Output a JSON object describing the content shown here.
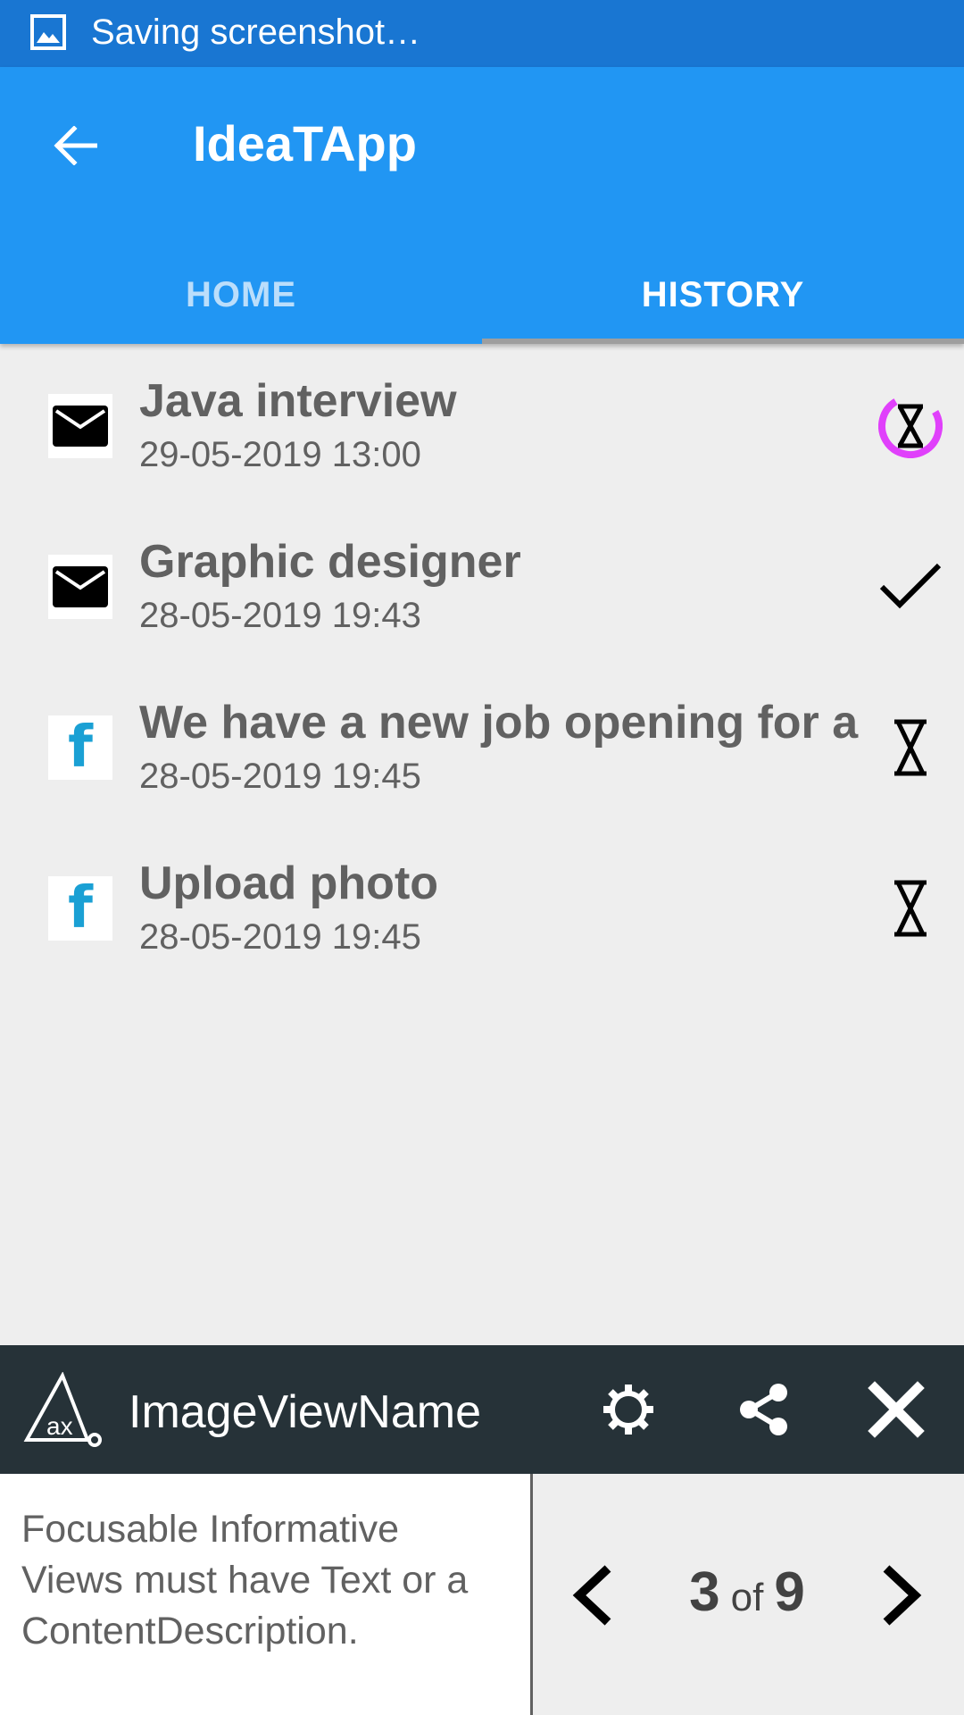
{
  "status_bar": {
    "icon": "image-icon",
    "text": "Saving screenshot…"
  },
  "app_bar": {
    "back_icon": "arrow-left-icon",
    "title": "IdeaTApp",
    "tabs": [
      {
        "label": "HOME",
        "selected": false
      },
      {
        "label": "HISTORY",
        "selected": true
      }
    ]
  },
  "history": {
    "items": [
      {
        "icon": "mail-icon",
        "title": "Java interview",
        "date": "29-05-2019 13:00",
        "status": "pending-hourglass-icon"
      },
      {
        "icon": "mail-icon",
        "title": "Graphic designer",
        "date": "28-05-2019 19:43",
        "status": "check-icon"
      },
      {
        "icon": "facebook-icon",
        "title": "We have a new job opening for a",
        "date": "28-05-2019 19:45",
        "status": "pending-hourglass-icon"
      },
      {
        "icon": "facebook-icon",
        "title": "Upload photo",
        "date": "28-05-2019 19:45",
        "status": "pending-hourglass-icon"
      }
    ],
    "facebook_glyph": "f"
  },
  "overlay": {
    "highlight_color": "#e040fb",
    "title": "ImageViewName",
    "message": "Focusable Informative Views must have Text or a ContentDescription.",
    "current": "3",
    "of_label": "of",
    "total": "9"
  },
  "colors": {
    "status_bar": "#1976d2",
    "app_bar": "#2196f3",
    "overlay_header": "#263238",
    "facebook": "#1aa0d4"
  }
}
